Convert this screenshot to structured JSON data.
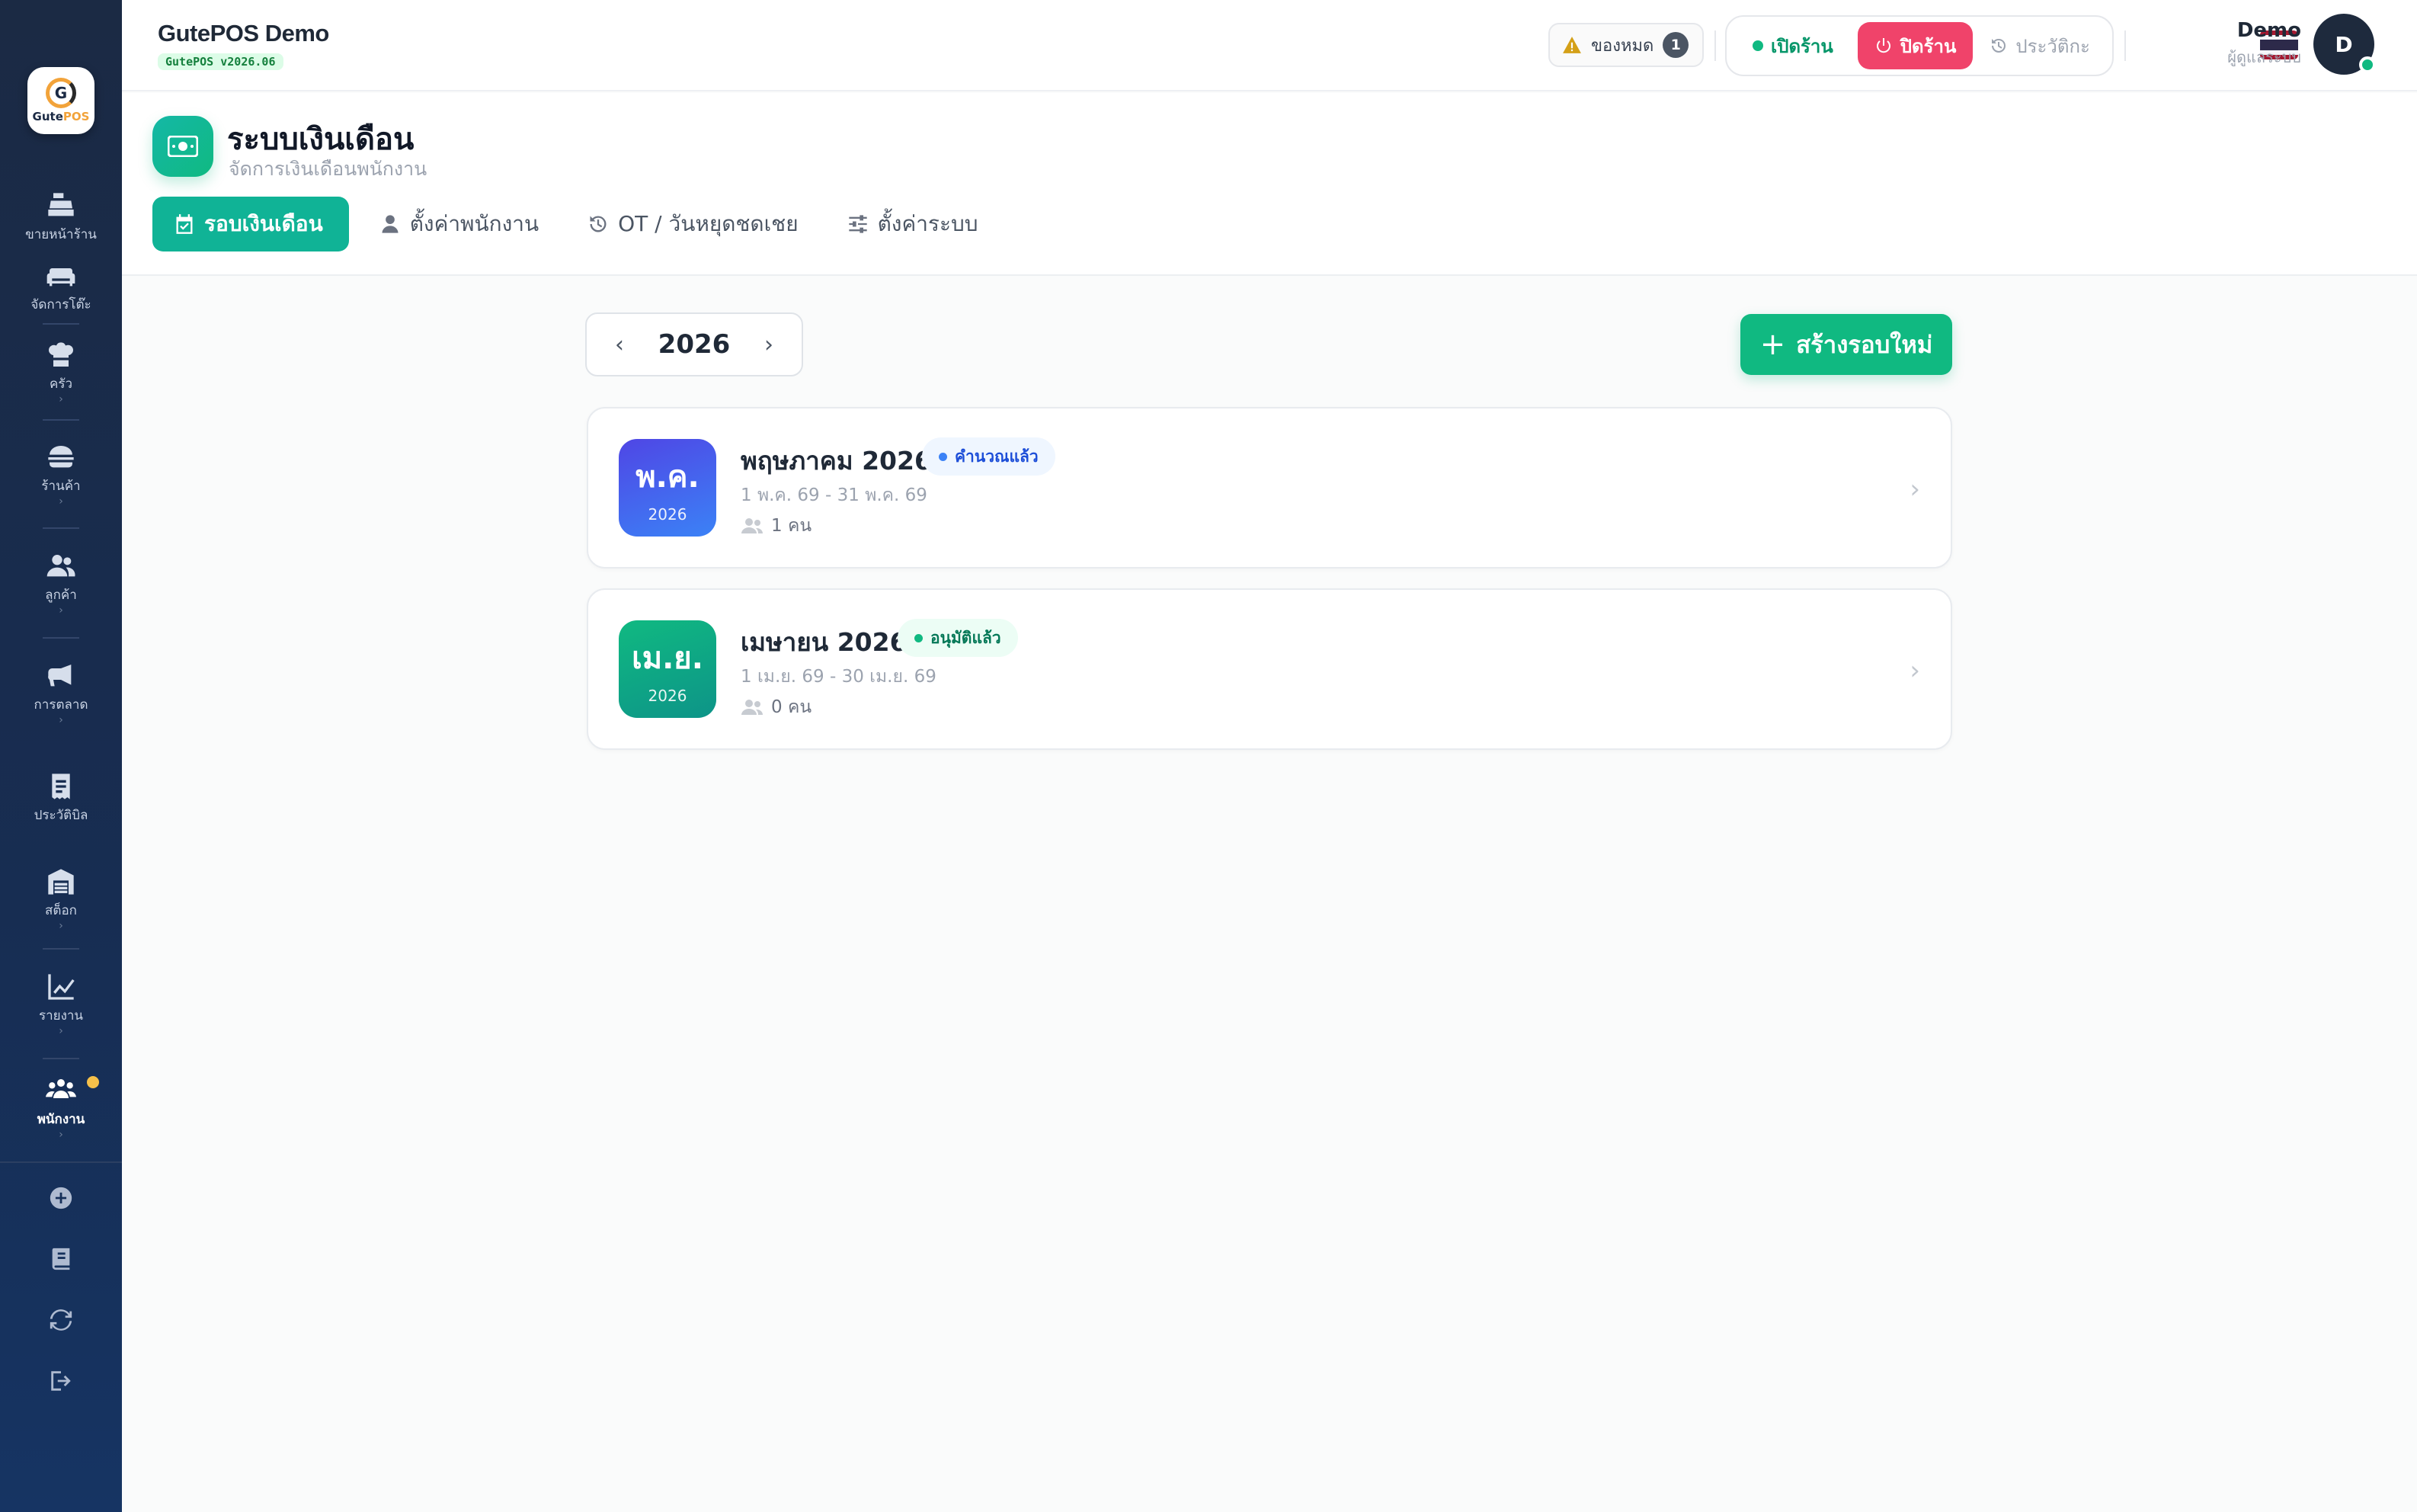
{
  "app": {
    "name": "GutePOS Demo",
    "version": "GutePOS v2026.06"
  },
  "logo": {
    "text_a": "Gute",
    "text_b": "POS"
  },
  "sidebar": {
    "items": [
      {
        "label": "ขายหน้าร้าน",
        "icon": "cash-register-icon",
        "chevron": ""
      },
      {
        "label": "จัดการโต๊ะ",
        "icon": "sofa-icon",
        "chevron": ""
      },
      {
        "label": "ครัว",
        "icon": "chef-icon",
        "chevron": "›"
      },
      {
        "label": "ร้านค้า",
        "icon": "burger-icon",
        "chevron": "›"
      },
      {
        "label": "ลูกค้า",
        "icon": "users-icon",
        "chevron": "›"
      },
      {
        "label": "การตลาด",
        "icon": "megaphone-icon",
        "chevron": "›"
      },
      {
        "label": "ประวัติบิล",
        "icon": "receipt-icon",
        "chevron": ""
      },
      {
        "label": "สต็อก",
        "icon": "warehouse-icon",
        "chevron": "›"
      },
      {
        "label": "รายงาน",
        "icon": "chart-line-icon",
        "chevron": "›"
      },
      {
        "label": "พนักงาน",
        "icon": "staff-icon",
        "chevron": "›"
      }
    ],
    "utilities": [
      "plus-circle-icon",
      "book-icon",
      "refresh-icon",
      "logout-icon"
    ]
  },
  "header": {
    "out_of_stock_label": "ของหมด",
    "out_of_stock_count": "1",
    "open_store": "เปิดร้าน",
    "close_store": "ปิดร้าน",
    "history": "ประวัติกะ",
    "language_flag": "thai-flag-icon",
    "user_name": "Demo",
    "user_role": "ผู้ดูแลระบบ",
    "avatar_initial": "D"
  },
  "page": {
    "title": "ระบบเงินเดือน",
    "subtitle": "จัดการเงินเดือนพนักงาน",
    "tabs": [
      {
        "label": "รอบเงินเดือน",
        "active": true
      },
      {
        "label": "ตั้งค่าพนักงาน",
        "active": false
      },
      {
        "label": "OT / วันหยุดชดเชย",
        "active": false
      },
      {
        "label": "ตั้งค่าระบบ",
        "active": false
      }
    ]
  },
  "year_picker": {
    "year": "2026",
    "prev": "‹",
    "next": "›"
  },
  "new_round_button": {
    "label": "สร้างรอบใหม่",
    "icon": "+"
  },
  "rounds": [
    {
      "badge_month": "พ.ค.",
      "badge_year": "2026",
      "title": "พฤษภาคม 2026",
      "status": "คำนวณแล้ว",
      "range": "1 พ.ค. 69 - 31 พ.ค. 69",
      "people": "1 คน"
    },
    {
      "badge_month": "เม.ย.",
      "badge_year": "2026",
      "title": "เมษายน 2026",
      "status": "อนุมัติแล้ว",
      "range": "1 เม.ย. 69 - 30 เม.ย. 69",
      "people": "0 คน"
    }
  ],
  "colors": {
    "accent": "#10b981",
    "close_red": "#f0436a",
    "sidebar_bg": "#1b2a44",
    "calculated_blue": "#3b82f6",
    "approved_green": "#10b981"
  }
}
